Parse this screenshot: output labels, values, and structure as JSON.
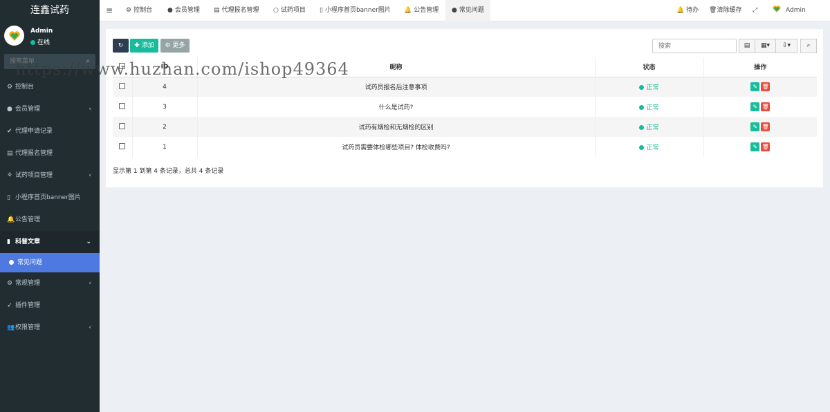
{
  "app": {
    "title": "连鑫试药"
  },
  "user": {
    "name": "Admin",
    "status": "在线"
  },
  "sidebar": {
    "search_placeholder": "搜索菜单",
    "items": [
      {
        "icon": "⚙",
        "label": "控制台",
        "arrow": ""
      },
      {
        "icon": "●",
        "label": "会员管理",
        "arrow": "‹"
      },
      {
        "icon": "✔",
        "label": "代理申请记录",
        "arrow": ""
      },
      {
        "icon": "▤",
        "label": "代理报名管理",
        "arrow": ""
      },
      {
        "icon": "⚘",
        "label": "试药项目管理",
        "arrow": "‹"
      },
      {
        "icon": "▯",
        "label": "小程序首页banner图片",
        "arrow": ""
      },
      {
        "icon": "🔔",
        "label": "公告管理",
        "arrow": ""
      },
      {
        "icon": "▮",
        "label": "科普文章",
        "arrow": "⌄"
      },
      {
        "icon": "",
        "label": "常见问题",
        "arrow": ""
      },
      {
        "icon": "⚙",
        "label": "常规管理",
        "arrow": "‹"
      },
      {
        "icon": "➶",
        "label": "插件管理",
        "arrow": ""
      },
      {
        "icon": "👥",
        "label": "权限管理",
        "arrow": "‹"
      }
    ]
  },
  "topnav": {
    "menu_icon": "≡",
    "tabs": [
      {
        "icon": "⚙",
        "label": "控制台"
      },
      {
        "icon": "●",
        "label": "会员管理"
      },
      {
        "icon": "▤",
        "label": "代理报名管理"
      },
      {
        "icon": "○",
        "label": "试药项目"
      },
      {
        "icon": "▯",
        "label": "小程序首页banner图片"
      },
      {
        "icon": "🔔",
        "label": "公告管理"
      },
      {
        "icon": "●",
        "label": "常见问题"
      }
    ],
    "right": {
      "todo": "待办",
      "clear_cache": "清除缓存",
      "fullscreen_icon": "⤢",
      "admin": "Admin"
    }
  },
  "toolbar": {
    "refresh_icon": "↻",
    "add_label": "✚ 添加",
    "more_label": "⚙ 更多",
    "search_placeholder": "搜索",
    "toggle_icon": "▤",
    "columns_icon": "▦▾",
    "export_icon": "⇩▾",
    "search_icon": "⌕"
  },
  "table": {
    "headers": [
      "",
      "ID",
      "昵称",
      "状态",
      "操作"
    ],
    "rows": [
      {
        "id": "4",
        "title": "试药员报名后注意事项",
        "status": "正常"
      },
      {
        "id": "3",
        "title": "什么是试药?",
        "status": "正常"
      },
      {
        "id": "2",
        "title": "试药有烟检和无烟检的区别",
        "status": "正常"
      },
      {
        "id": "1",
        "title": "试药员需要体检哪些项目? 体检收费吗?",
        "status": "正常"
      }
    ],
    "edit_icon": "✎",
    "delete_icon": "🗑"
  },
  "pagination": {
    "info": "显示第 1 到第 4 条记录，总共 4 条记录"
  },
  "watermark": "https://www.huzhan.com/ishop49364",
  "colors": {
    "sidebar_bg": "#222d32",
    "active_bg": "#4d79e0",
    "success": "#18bc9c",
    "danger": "#e74c3c"
  }
}
